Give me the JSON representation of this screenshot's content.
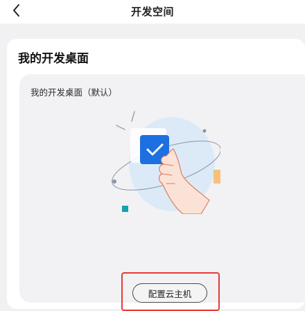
{
  "header": {
    "title": "开发空间",
    "back_icon": "chevron-left-icon"
  },
  "section": {
    "title": "我的开发桌面"
  },
  "desktop_card": {
    "title": "我的开发桌面（默认）",
    "illustration": "hand-thumbs-up-checkmark-illustration",
    "config_button_label": "配置云主机"
  },
  "colors": {
    "accent_blue": "#1e6fe0",
    "highlight_red": "#e53935",
    "hand_fill": "#fbe2d6",
    "orbit_blue": "#dceaf8",
    "orange_square": "#f6b45a",
    "teal_square": "#14a3b0"
  }
}
